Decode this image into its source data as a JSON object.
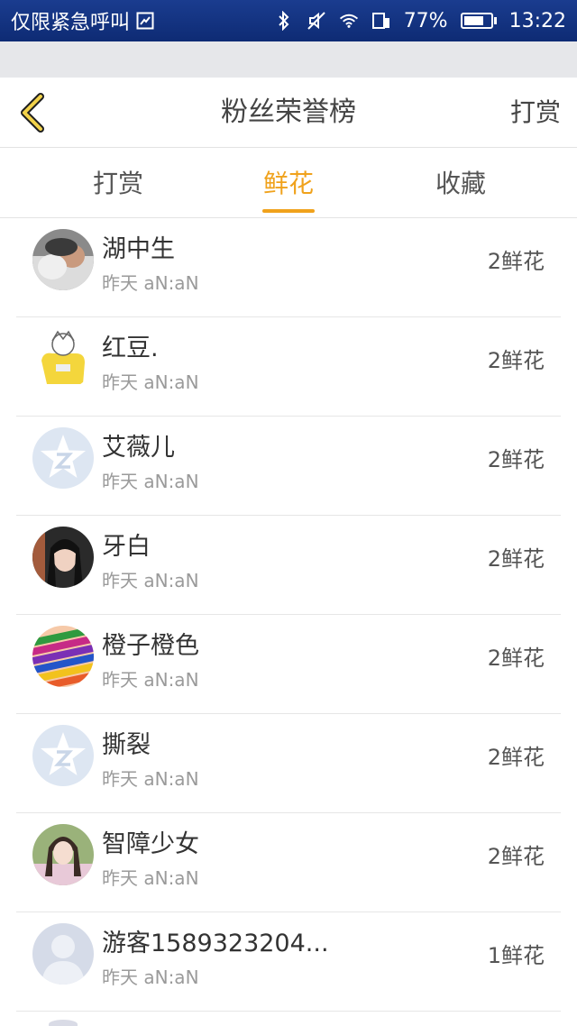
{
  "status_bar": {
    "carrier": "仅限紧急呼叫",
    "battery_percent": "77%",
    "battery_level": 0.77,
    "time": "13:22",
    "icons": [
      "sim-icon",
      "bluetooth-icon",
      "mute-icon",
      "wifi-icon",
      "data-icon",
      "battery-icon"
    ]
  },
  "nav": {
    "title": "粉丝荣誉榜",
    "right_label": "打赏",
    "back_icon": "chevron-left-icon",
    "accent_color": "#f0a21c"
  },
  "tabs": [
    {
      "label": "打赏",
      "active": false
    },
    {
      "label": "鲜花",
      "active": true
    },
    {
      "label": "收藏",
      "active": false
    }
  ],
  "fans": [
    {
      "name": "湖中生",
      "time": "昨天 aN:aN",
      "count": "2鲜花",
      "avatar": "photo-baby"
    },
    {
      "name": "红豆.",
      "time": "昨天 aN:aN",
      "count": "2鲜花",
      "avatar": "cartoon-yellow"
    },
    {
      "name": "艾薇儿",
      "time": "昨天 aN:aN",
      "count": "2鲜花",
      "avatar": "default-star"
    },
    {
      "name": "牙白",
      "time": "昨天 aN:aN",
      "count": "2鲜花",
      "avatar": "photo-girl-dark"
    },
    {
      "name": "橙子橙色",
      "time": "昨天 aN:aN",
      "count": "2鲜花",
      "avatar": "photo-crayons"
    },
    {
      "name": "撕裂",
      "time": "昨天 aN:aN",
      "count": "2鲜花",
      "avatar": "default-star"
    },
    {
      "name": "智障少女",
      "time": "昨天 aN:aN",
      "count": "2鲜花",
      "avatar": "photo-girl-light"
    },
    {
      "name": "游客1589323204...",
      "time": "昨天 aN:aN",
      "count": "1鲜花",
      "avatar": "default-person"
    }
  ]
}
